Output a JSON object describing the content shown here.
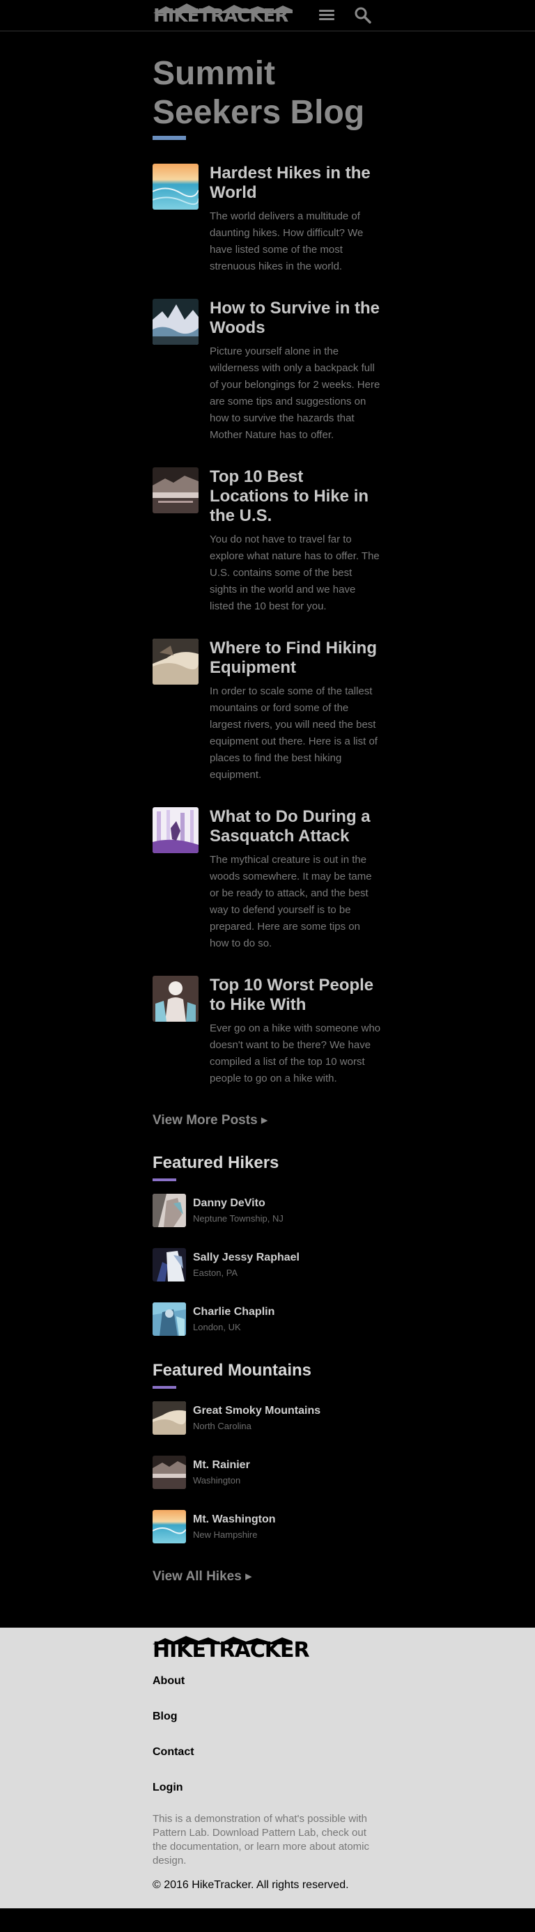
{
  "header": {
    "logo_text": "HIKETRACKER",
    "menu_icon": "hamburger-menu-icon",
    "search_icon": "search-icon"
  },
  "main": {
    "title": "Summit Seekers Blog",
    "posts": [
      {
        "title": "Hardest Hikes in the World",
        "excerpt": "The world delivers a multitude of daunting hikes. How difficult? We have listed some of the most strenuous hikes in the world."
      },
      {
        "title": "How to Survive in the Woods",
        "excerpt": "Picture yourself alone in the wilderness with only a backpack full of your belongings for 2 weeks. Here are some tips and suggestions on how to survive the hazards that Mother Nature has to offer."
      },
      {
        "title": "Top 10 Best Locations to Hike in the U.S.",
        "excerpt": "You do not have to travel far to explore what nature has to offer. The U.S. contains some of the best sights in the world and we have listed the 10 best for you."
      },
      {
        "title": "Where to Find Hiking Equipment",
        "excerpt": "In order to scale some of the tallest mountains or ford some of the largest rivers, you will need the best equipment out there. Here is a list of places to find the best hiking equipment."
      },
      {
        "title": "What to Do During a Sasquatch Attack",
        "excerpt": "The mythical creature is out in the woods somewhere. It may be tame or be ready to attack, and the best way to defend yourself is to be prepared. Here are some tips on how to do so."
      },
      {
        "title": "Top 10 Worst People to Hike With",
        "excerpt": "Ever go on a hike with someone who doesn't want to be there? We have compiled a list of the top 10 worst people to go on a hike with."
      }
    ],
    "view_more": "View More Posts ▸",
    "featured_hikers_title": "Featured Hikers",
    "hikers": [
      {
        "name": "Danny DeVito",
        "location": "Neptune Township, NJ"
      },
      {
        "name": "Sally Jessy Raphael",
        "location": "Easton, PA"
      },
      {
        "name": "Charlie Chaplin",
        "location": "London, UK"
      }
    ],
    "featured_mountains_title": "Featured Mountains",
    "mountains": [
      {
        "name": "Great Smoky Mountains",
        "location": "North Carolina"
      },
      {
        "name": "Mt. Rainier",
        "location": "Washington"
      },
      {
        "name": "Mt. Washington",
        "location": "New Hampshire"
      }
    ],
    "view_all": "View All Hikes ▸"
  },
  "footer": {
    "logo_text": "HIKETRACKER",
    "nav": [
      "About",
      "Blog",
      "Contact",
      "Login"
    ],
    "note": "This is a demonstration of what's possible with Pattern Lab. Download Pattern Lab, check out the documentation, or learn more about atomic design.",
    "copyright": "© 2016 HikeTracker. All rights reserved."
  },
  "colors": {
    "background": "#000000",
    "title_accent": "#6a8fbf",
    "section_accent": "#8b72c8",
    "footer_bg": "#dcdcdc"
  }
}
